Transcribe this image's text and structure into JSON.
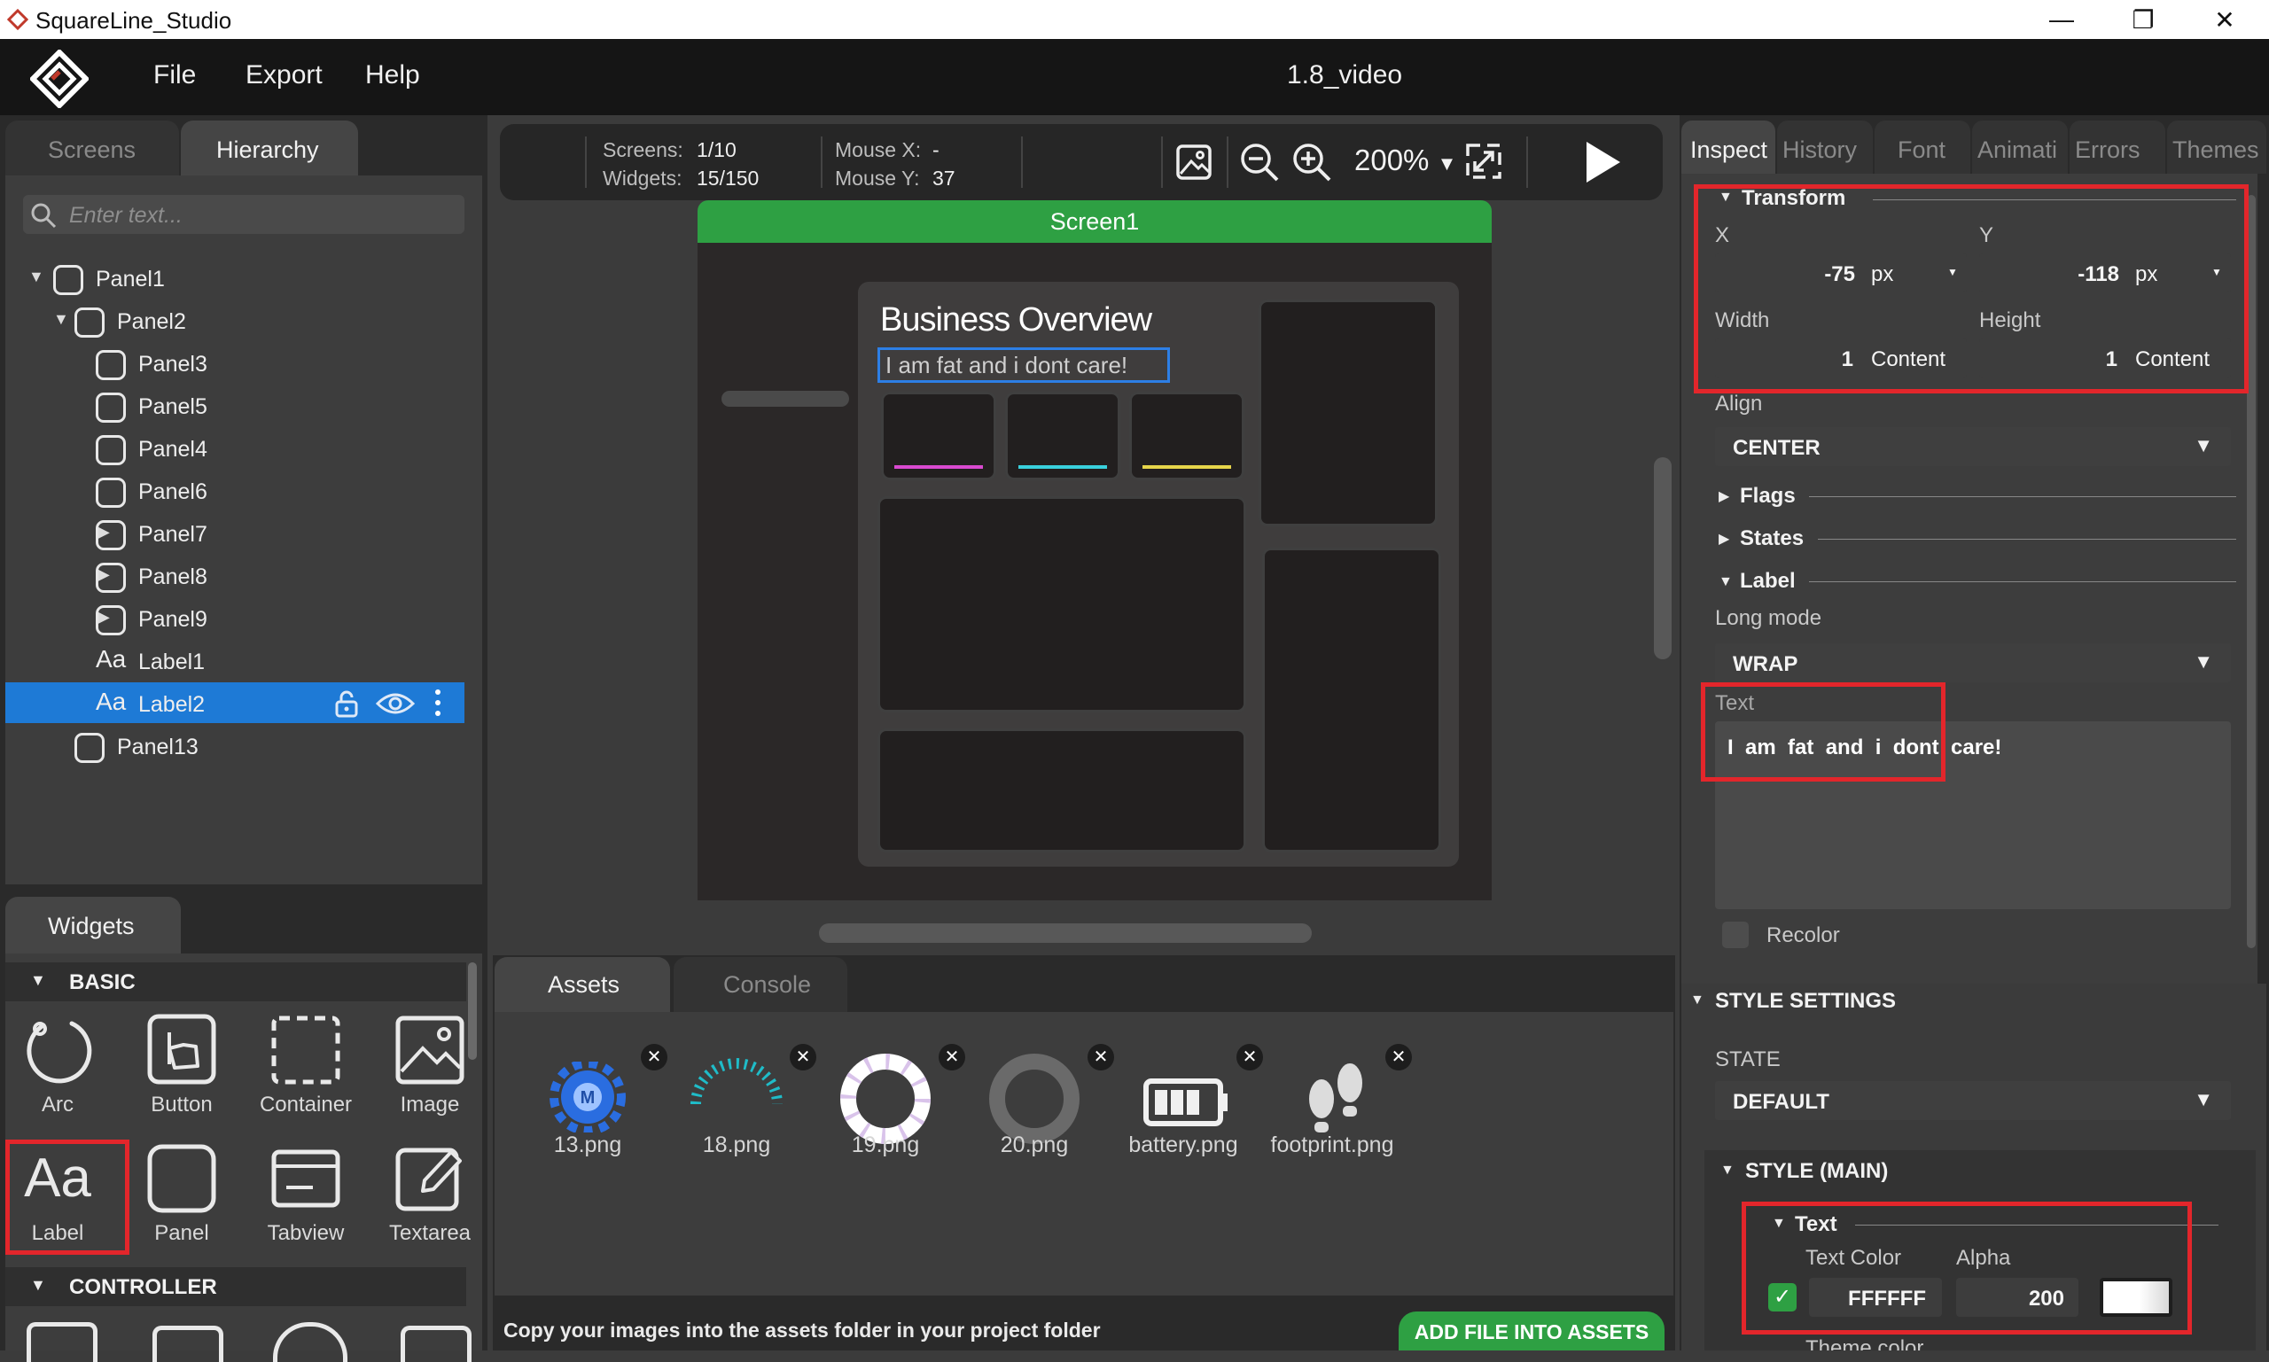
{
  "window": {
    "title": "SquareLine_Studio",
    "minimize": "—",
    "maximize": "❐",
    "close": "✕"
  },
  "menu": {
    "items": [
      "File",
      "Export",
      "Help"
    ],
    "project_name": "1.8_video"
  },
  "left_panel": {
    "tabs": [
      "Screens",
      "Hierarchy"
    ],
    "active_tab": "Hierarchy",
    "search_placeholder": "Enter text...",
    "tree": [
      {
        "label": "Panel1",
        "type": "panel",
        "level": 0,
        "expander": "▼"
      },
      {
        "label": "Panel2",
        "type": "panel",
        "level": 1,
        "expander": "▼"
      },
      {
        "label": "Panel3",
        "type": "panel",
        "level": 2,
        "expander": ""
      },
      {
        "label": "Panel5",
        "type": "panel",
        "level": 2,
        "expander": ""
      },
      {
        "label": "Panel4",
        "type": "panel",
        "level": 2,
        "expander": ""
      },
      {
        "label": "Panel6",
        "type": "panel",
        "level": 2,
        "expander": ""
      },
      {
        "label": "Panel7",
        "type": "panel",
        "level": 2,
        "expander": "▶"
      },
      {
        "label": "Panel8",
        "type": "panel",
        "level": 2,
        "expander": "▶"
      },
      {
        "label": "Panel9",
        "type": "panel",
        "level": 2,
        "expander": "▶"
      },
      {
        "label": "Label1",
        "type": "label",
        "level": 2,
        "expander": ""
      },
      {
        "label": "Label2",
        "type": "label",
        "level": 2,
        "expander": "",
        "selected": true
      },
      {
        "label": "Panel13",
        "type": "panel",
        "level": 1,
        "expander": ""
      }
    ],
    "label_glyph": "Aa"
  },
  "widgets_panel": {
    "tab": "Widgets",
    "basic_header": "BASIC",
    "controller_header": "CONTROLLER",
    "basic_items": [
      "Arc",
      "Button",
      "Container",
      "Image",
      "Label",
      "Panel",
      "Tabview",
      "Textarea"
    ],
    "label_glyph": "Aa"
  },
  "canvas_toolbar": {
    "screens_label": "Screens:",
    "screens_value": "1/10",
    "widgets_label": "Widgets:",
    "widgets_value": "15/150",
    "mouse_x_label": "Mouse X:",
    "mouse_x_value": "-",
    "mouse_y_label": "Mouse Y:",
    "mouse_y_value": "37",
    "zoom": "200%",
    "zoom_caret": "▼"
  },
  "canvas": {
    "screen_name": "Screen1",
    "heading": "Business Overview",
    "label_text": "I  am  fat  and  i  dont  care!",
    "accent_colors": [
      "#d94ad0",
      "#39d0dc",
      "#e6d44a"
    ],
    "screen_tab_color": "#2ea043"
  },
  "bottom_panel": {
    "tabs": [
      "Assets",
      "Console"
    ],
    "active_tab": "Assets",
    "assets": [
      {
        "name": "13.png",
        "icon": "gear-logo-icon"
      },
      {
        "name": "18.png",
        "icon": "gauge-arc-icon"
      },
      {
        "name": "19.png",
        "icon": "ring-white-icon"
      },
      {
        "name": "20.png",
        "icon": "ring-gray-icon"
      },
      {
        "name": "battery.png",
        "icon": "battery-icon"
      },
      {
        "name": "footprint.png",
        "icon": "footprint-icon"
      }
    ],
    "remove_glyph": "✕",
    "hint": "Copy your images into the assets folder in your project folder",
    "add_button": "ADD FILE INTO ASSETS"
  },
  "inspector": {
    "tabs": [
      "Inspect",
      "History",
      "Font",
      "Animati",
      "Errors",
      "Themes"
    ],
    "active_tab": "Inspect",
    "transform": {
      "header": "Transform",
      "x_label": "X",
      "y_label": "Y",
      "x_value": "-75",
      "x_unit": "px",
      "y_value": "-118",
      "y_unit": "px",
      "width_label": "Width",
      "height_label": "Height",
      "width_value": "1",
      "width_unit": "Content",
      "height_value": "1",
      "height_unit": "Content"
    },
    "align_label": "Align",
    "align_value": "CENTER",
    "flags_header": "Flags",
    "states_header": "States",
    "label_header": "Label",
    "long_mode_label": "Long mode",
    "long_mode_value": "WRAP",
    "text_label": "Text",
    "text_value": "I  am  fat  and  i  dont  care!",
    "recolor_label": "Recolor",
    "style_settings_header": "STYLE SETTINGS",
    "state_label": "STATE",
    "state_value": "DEFAULT",
    "style_main_header": "STYLE (MAIN)",
    "text_sub_header": "Text",
    "text_color_label": "Text Color",
    "alpha_label": "Alpha",
    "text_color_value": "FFFFFF",
    "alpha_value": "200",
    "theme_color_label": "Theme color"
  }
}
